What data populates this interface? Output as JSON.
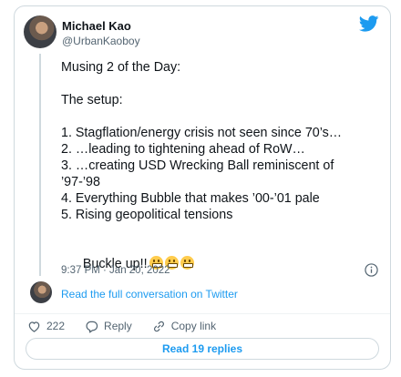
{
  "author": {
    "name": "Michael Kao",
    "handle": "@UrbanKaoboy"
  },
  "tweet": {
    "lines": [
      "Musing 2 of the Day:",
      "",
      "The setup:",
      "",
      "1. Stagflation/energy crisis not seen since 70’s…",
      "2. …leading to tightening ahead of RoW…",
      "3. …creating USD Wrecking Ball reminiscent of",
      "’97-’98",
      "4. Everything Bubble that makes ’00-’01 pale",
      "5. Rising geopolitical tensions",
      "",
      "Buckle up!!"
    ],
    "emoji_count": 3,
    "emoji_name": "grimacing-face",
    "timestamp": "9:37 PM · Jan 20, 2022"
  },
  "conversation_link": "Read the full conversation on Twitter",
  "actions": {
    "likes": "222",
    "reply_label": "Reply",
    "copy_label": "Copy link"
  },
  "read_replies": "Read 19 replies",
  "colors": {
    "accent": "#1d9bf0",
    "text": "#0f1419",
    "muted": "#536471",
    "border": "#cfd9de"
  },
  "icons": [
    "twitter-bird-icon",
    "info-icon",
    "heart-icon",
    "reply-bubble-icon",
    "copy-link-icon"
  ]
}
